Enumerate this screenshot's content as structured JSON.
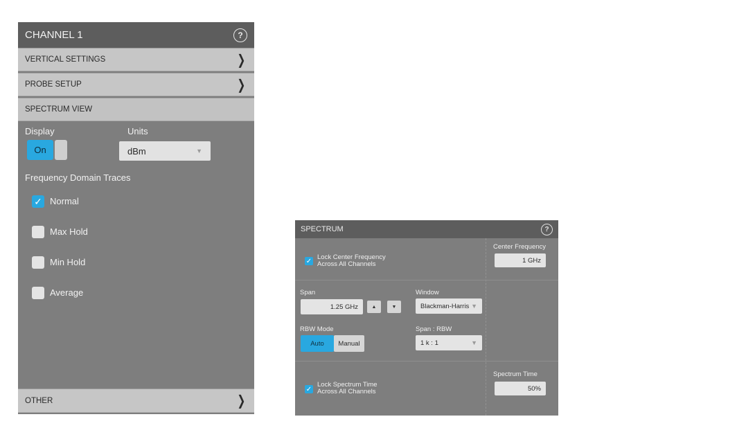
{
  "channel_panel": {
    "title": "CHANNEL 1",
    "help_icon": "?",
    "sections": {
      "vertical_settings": "VERTICAL SETTINGS",
      "probe_setup": "PROBE SETUP",
      "spectrum_view": "SPECTRUM VIEW",
      "other": "OTHER"
    },
    "chevron": "❯",
    "display_label": "Display",
    "display_toggle": "On",
    "units_label": "Units",
    "units_value": "dBm",
    "traces_label": "Frequency Domain Traces",
    "traces": [
      {
        "label": "Normal",
        "checked": true
      },
      {
        "label": "Max Hold",
        "checked": false
      },
      {
        "label": "Min Hold",
        "checked": false
      },
      {
        "label": "Average",
        "checked": false
      }
    ]
  },
  "spectrum_panel": {
    "title": "SPECTRUM",
    "help_icon": "?",
    "lock_center_line1": "Lock Center Frequency",
    "lock_center_line2": "Across All Channels",
    "center_freq_label": "Center Frequency",
    "center_freq_value": "1 GHz",
    "span_label": "Span",
    "span_value": "1.25 GHz",
    "window_label": "Window",
    "window_value": "Blackman-Harris",
    "rbw_mode_label": "RBW Mode",
    "rbw_auto": "Auto",
    "rbw_manual": "Manual",
    "span_rbw_label": "Span : RBW",
    "span_rbw_value": "1 k : 1",
    "lock_time_line1": "Lock Spectrum Time",
    "lock_time_line2": "Across All Channels",
    "spectrum_time_label": "Spectrum Time",
    "spectrum_time_value": "50%"
  },
  "colors": {
    "accent": "#29a8e0",
    "panel_bg": "#7e7e7e",
    "header_bg": "#5d5d5d",
    "row_bg": "#c6c6c6"
  },
  "icons": [
    "help-icon",
    "chevron-right-icon",
    "checkmark-icon",
    "dropdown-caret-icon",
    "arrow-up-icon",
    "arrow-down-icon"
  ]
}
